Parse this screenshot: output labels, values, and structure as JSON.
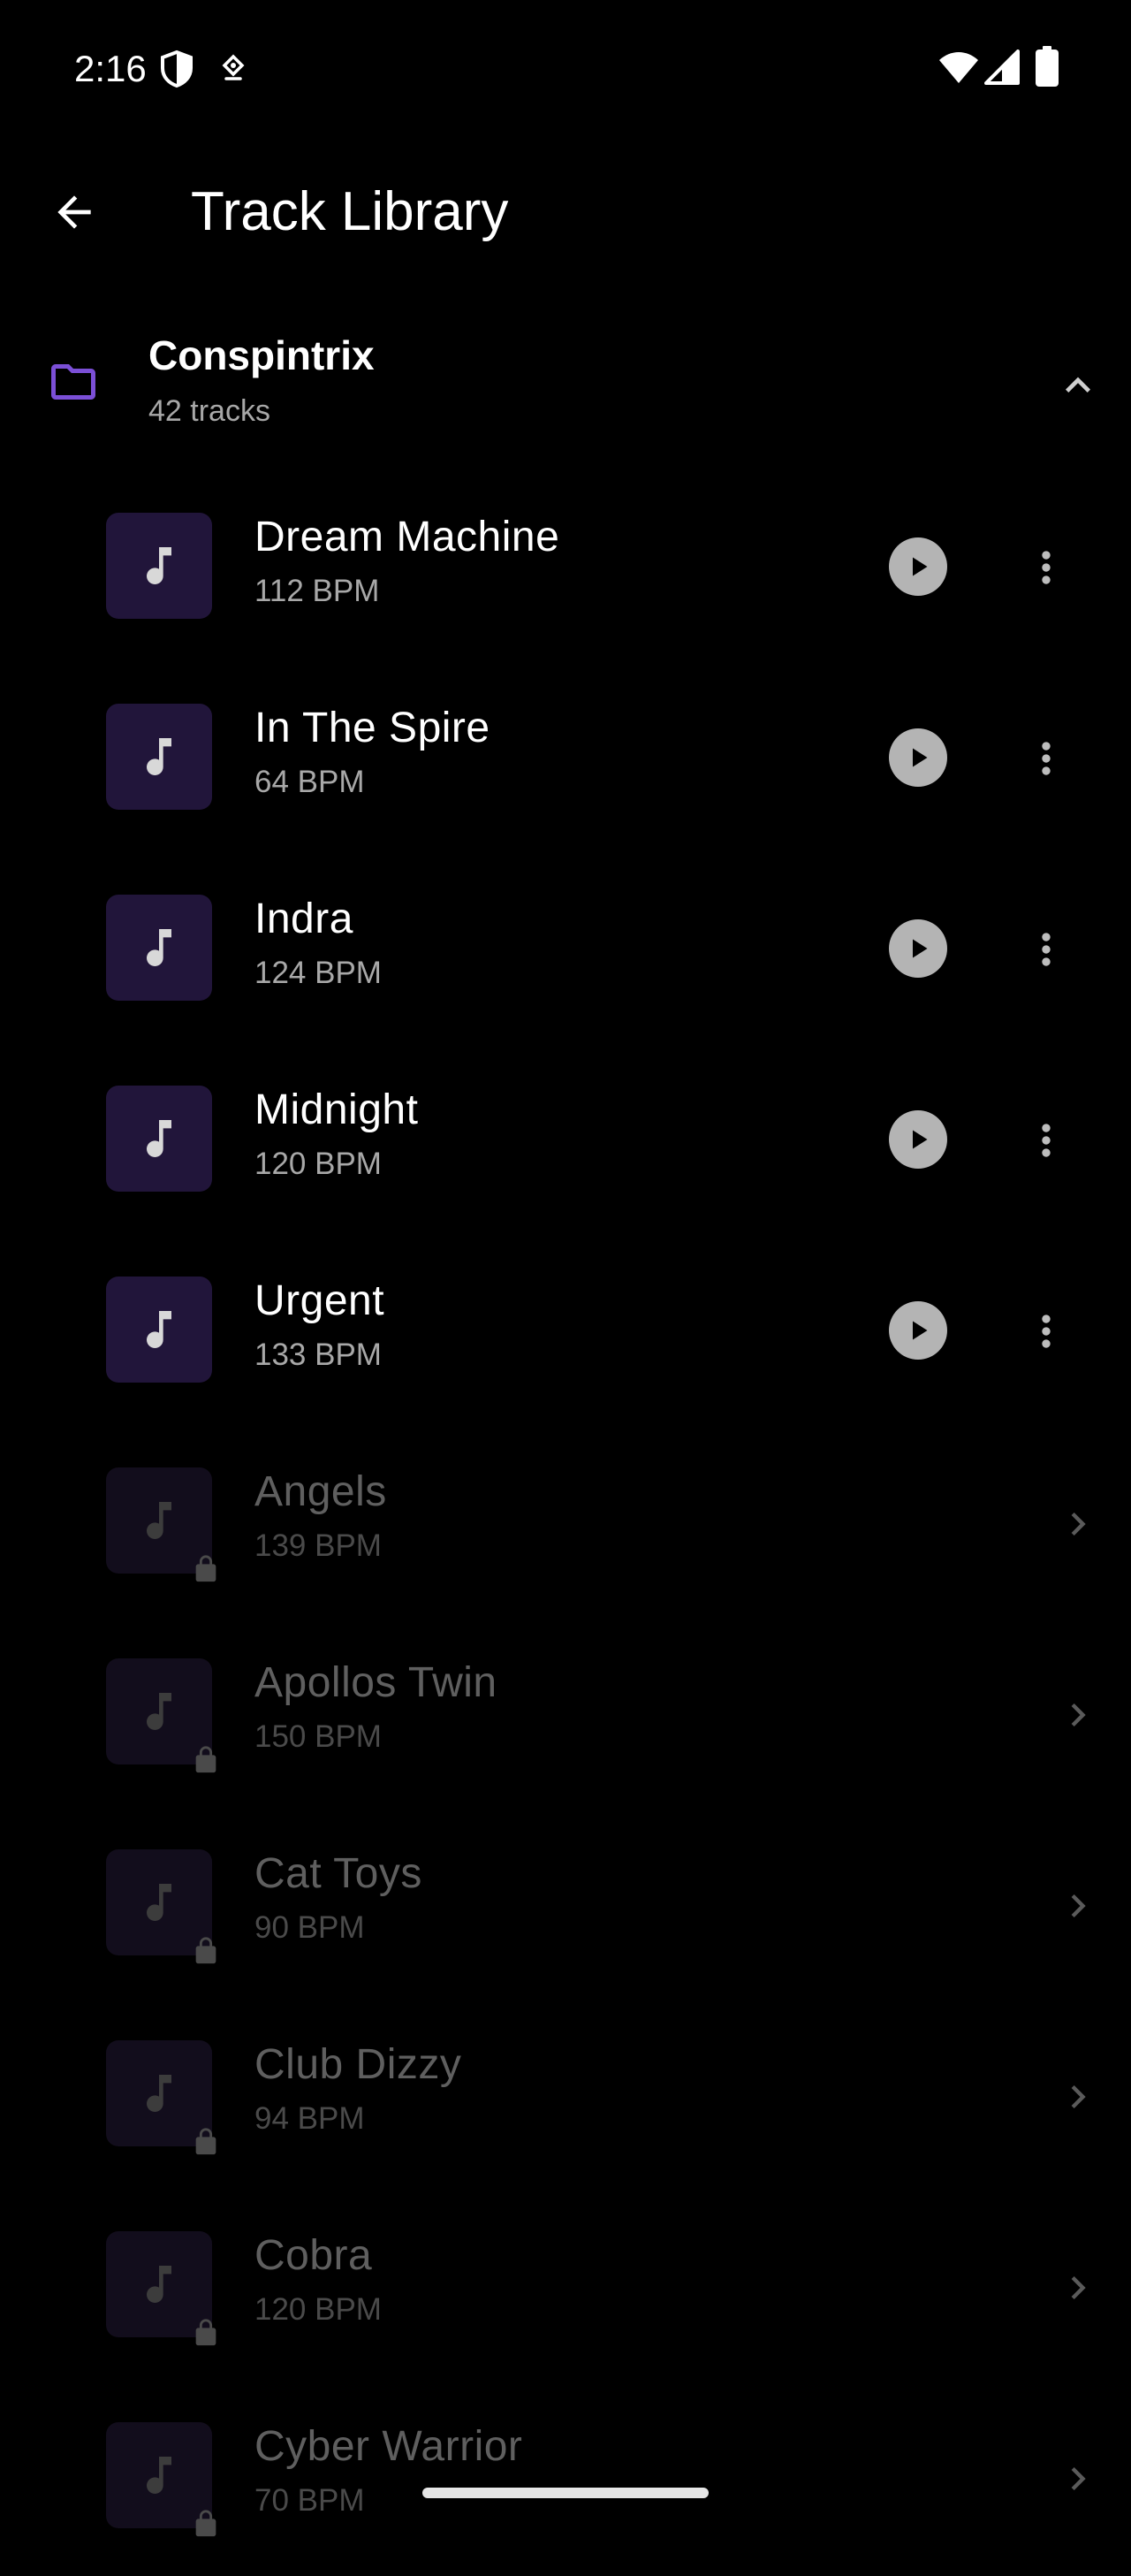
{
  "status_bar": {
    "time": "2:16",
    "icons": [
      "shield-icon",
      "tether-icon",
      "wifi-icon",
      "signal-icon",
      "battery-icon"
    ]
  },
  "app_bar": {
    "title": "Track Library",
    "back_icon": "arrow-back-icon"
  },
  "folder": {
    "name": "Conspintrix",
    "count": "42 tracks",
    "icon": "folder-icon",
    "accent_color": "#7b4fd6",
    "expanded": true
  },
  "tracks": [
    {
      "title": "Dream Machine",
      "bpm": "112 BPM",
      "locked": false
    },
    {
      "title": "In The Spire",
      "bpm": "64 BPM",
      "locked": false
    },
    {
      "title": "Indra",
      "bpm": "124 BPM",
      "locked": false
    },
    {
      "title": "Midnight",
      "bpm": "120 BPM",
      "locked": false
    },
    {
      "title": "Urgent",
      "bpm": "133 BPM",
      "locked": false
    },
    {
      "title": "Angels",
      "bpm": "139 BPM",
      "locked": true
    },
    {
      "title": "Apollos Twin",
      "bpm": "150 BPM",
      "locked": true
    },
    {
      "title": "Cat Toys",
      "bpm": "90 BPM",
      "locked": true
    },
    {
      "title": "Club Dizzy",
      "bpm": "94 BPM",
      "locked": true
    },
    {
      "title": "Cobra",
      "bpm": "120 BPM",
      "locked": true
    },
    {
      "title": "Cyber Warrior",
      "bpm": "70 BPM",
      "locked": true
    }
  ],
  "colors": {
    "background": "#000000",
    "thumb_bg": "#21153a",
    "thumb_bg_locked": "#120d1c",
    "text_primary": "#ffffff",
    "text_secondary": "#a8a8a8",
    "text_locked": "#5f5f5f"
  }
}
